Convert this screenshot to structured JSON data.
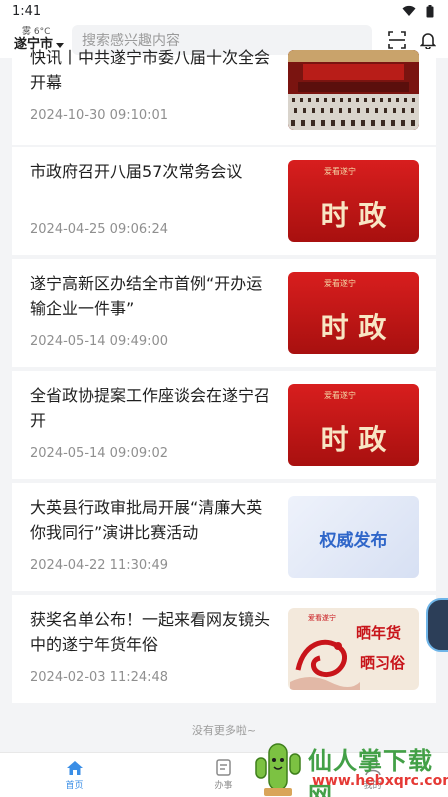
{
  "status_bar": {
    "time": "1:41"
  },
  "header": {
    "weather": "雾 6°C",
    "city": "遂宁市",
    "search_placeholder": "搜索感兴趣内容"
  },
  "news": [
    {
      "title": "快讯丨中共遂宁市委八届十次全会开幕",
      "date": "2024-10-30 09:10:01",
      "thumb": "meeting-photo"
    },
    {
      "title": "市政府召开八届57次常务会议",
      "date": "2024-04-25 09:06:24",
      "thumb": "shizheng-banner",
      "thumb_text": "时 政",
      "thumb_brand": "爱看遂宁"
    },
    {
      "title": "遂宁高新区办结全市首例“开办运输企业一件事”",
      "date": "2024-05-14 09:49:00",
      "thumb": "shizheng-banner",
      "thumb_text": "时 政",
      "thumb_brand": "爱看遂宁"
    },
    {
      "title": "全省政协提案工作座谈会在遂宁召开",
      "date": "2024-05-14 09:09:02",
      "thumb": "shizheng-banner",
      "thumb_text": "时 政",
      "thumb_brand": "爱看遂宁"
    },
    {
      "title": "大英县行政审批局开展“清廉大英 你我同行”演讲比赛活动",
      "date": "2024-04-22 11:30:49",
      "thumb": "quanwei-banner",
      "thumb_text": "权威发布"
    },
    {
      "title": "获奖名单公布！一起来看网友镜头中的遂宁年货年俗",
      "date": "2024-02-03 11:24:48",
      "thumb": "newyear-banner",
      "thumb_text_1": "晒年货",
      "thumb_text_2": "晒习俗",
      "thumb_brand": "爱看遂宁"
    }
  ],
  "footer_text": "没有更多啦~",
  "bottom_nav": [
    {
      "label": "首页",
      "icon": "home-icon",
      "active": true
    },
    {
      "label": "办事",
      "icon": "document-icon",
      "active": false
    },
    {
      "label": "我的",
      "icon": "user-icon",
      "active": false
    }
  ],
  "watermark": {
    "name": "仙人掌下载网",
    "url": "www.hebxqrc.com"
  },
  "colors": {
    "accent": "#3a8ee6",
    "banner_red": "#c8141a",
    "banner_gold": "#f5d9a8"
  }
}
